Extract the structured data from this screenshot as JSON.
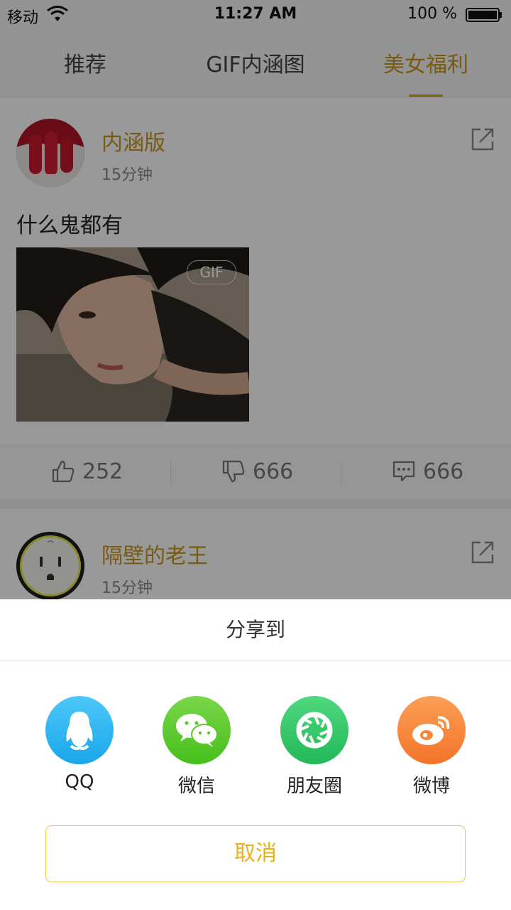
{
  "status_bar": {
    "carrier": "移动",
    "time": "11:27 AM",
    "battery_percent": "100 %"
  },
  "tabs": [
    {
      "label": "推荐",
      "active": false
    },
    {
      "label": "GIF内涵图",
      "active": false
    },
    {
      "label": "美女福利",
      "active": true
    }
  ],
  "posts": [
    {
      "username": "内涵版",
      "time": "15分钟",
      "text": "什么鬼都有",
      "badge": "GIF",
      "likes": "252",
      "dislikes": "666",
      "comments": "666"
    },
    {
      "username": "隔壁的老王",
      "time": "15分钟"
    }
  ],
  "share_sheet": {
    "title": "分享到",
    "targets": [
      {
        "label": "QQ",
        "icon": "qq-icon",
        "color": "#2bb5f1"
      },
      {
        "label": "微信",
        "icon": "wechat-icon",
        "color": "#5ccb2a"
      },
      {
        "label": "朋友圈",
        "icon": "moments-icon",
        "color": "#35c96a"
      },
      {
        "label": "微博",
        "icon": "weibo-icon",
        "color": "#f58a3a"
      }
    ],
    "cancel": "取消"
  },
  "colors": {
    "accent": "#c8961e",
    "cancel_border": "#e8c24a"
  }
}
